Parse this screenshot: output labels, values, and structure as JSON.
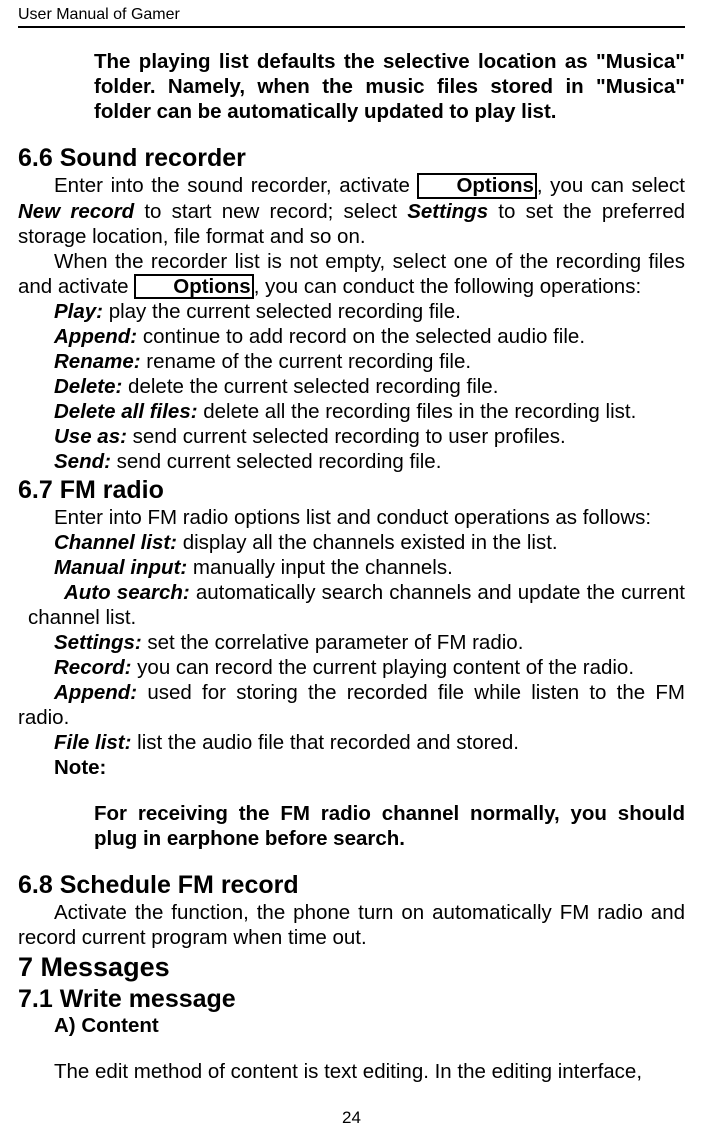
{
  "header": {
    "title": "User Manual of Gamer"
  },
  "intro_note": "The playing list defaults the selective location as \"Musica\" folder. Namely, when the music files stored in \"Musica\" folder can be automatically updated to play list.",
  "s66": {
    "heading": "6.6  Sound recorder",
    "p1_a": "Enter into the sound recorder, activate ",
    "p1_opt": "Options",
    "p1_b": ", you can select ",
    "p1_c": "New record",
    "p1_d": " to start new record; select ",
    "p1_e": "Settings",
    "p1_f": " to set the preferred storage location, file format and so on.",
    "p2_a": "When the recorder list is not empty, select one of the recording files and activate ",
    "p2_opt": "Options",
    "p2_b": ", you can conduct the following operations:",
    "items": {
      "play_l": "Play:",
      "play_t": " play the current selected recording file.",
      "append_l": "Append:",
      "append_t": " continue to add record on the selected audio file.",
      "rename_l": "Rename:",
      "rename_t": " rename of the current recording file.",
      "delete_l": "Delete:",
      "delete_t": " delete the current selected recording file.",
      "delall_l": "Delete all files:",
      "delall_t": " delete all the recording files in the recording list.",
      "useas_l": "Use as:",
      "useas_t": " send current selected recording to user profiles.",
      "send_l": "Send:",
      "send_t": " send current selected recording file."
    }
  },
  "s67": {
    "heading": "6.7  FM radio",
    "p1": "Enter into FM radio options list and conduct operations as follows:",
    "items": {
      "chlist_l": "Channel list:",
      "chlist_t": " display all the channels existed in the list.",
      "manual_l": "Manual input:",
      "manual_t": " manually input the channels.",
      "auto_l": "Auto search:",
      "auto_t": " automatically search channels and update the current channel list.",
      "settings_l": "Settings:",
      "settings_t": " set the correlative parameter of FM radio.",
      "record_l": "Record:",
      "record_t": " you can record the current playing content of the radio.",
      "append_l": "Append:",
      "append_t": " used for storing the recorded file while listen to the FM radio.",
      "filelist_l": "File list:",
      "filelist_t": " list the audio file that recorded and stored."
    },
    "note_label": "Note:",
    "note_text": "For receiving the FM radio channel normally, you should plug in earphone before search."
  },
  "s68": {
    "heading": "6.8   Schedule FM record",
    "p1": "Activate the function, the phone turn on automatically FM radio and record current program when time out."
  },
  "s7": {
    "heading": "7   Messages"
  },
  "s71": {
    "heading": "7.1  Write message",
    "sub": "A)   Content",
    "p1": "The edit method of content is text editing. In the editing interface,"
  },
  "footer": {
    "page": "24"
  }
}
